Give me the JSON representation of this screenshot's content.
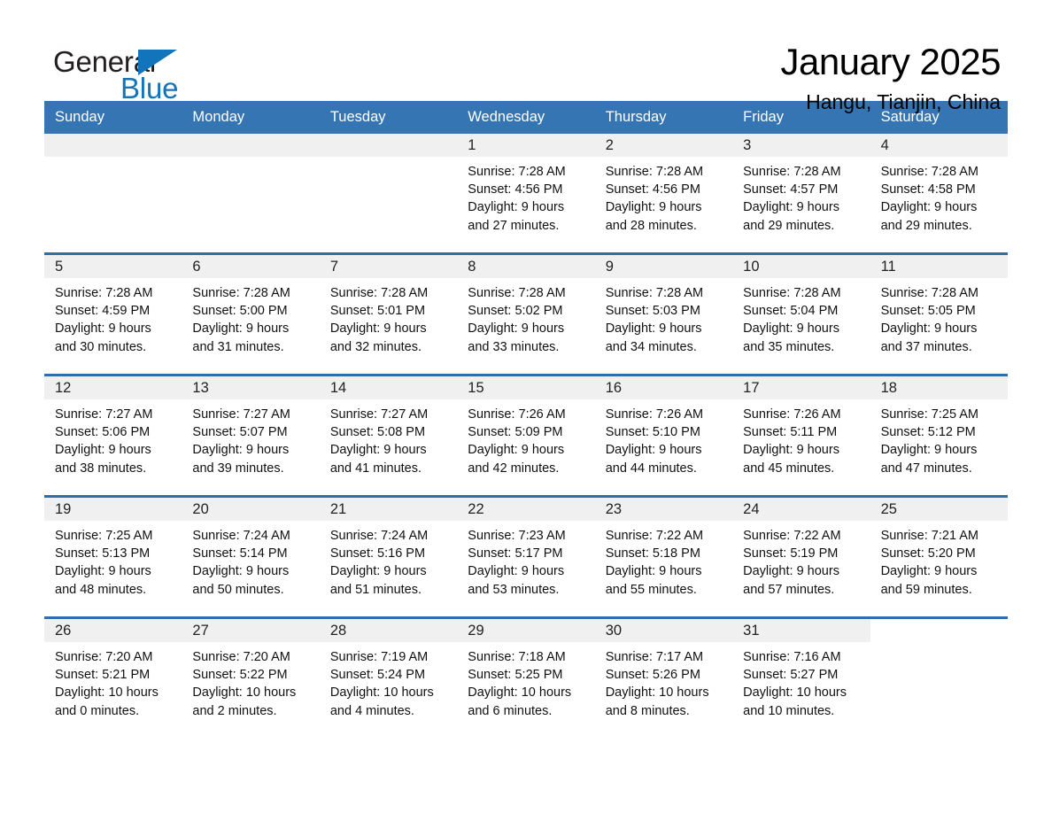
{
  "brand": {
    "name_part1": "General",
    "name_part2": "Blue",
    "accent_color": "#1274bb"
  },
  "header": {
    "title": "January 2025",
    "location": "Hangu, Tianjin, China"
  },
  "calendar": {
    "header_bg": "#3575b3",
    "row_border_color": "#2f6ea8",
    "daycell_head_bg": "#f0f0f0",
    "weekdays": [
      "Sunday",
      "Monday",
      "Tuesday",
      "Wednesday",
      "Thursday",
      "Friday",
      "Saturday"
    ],
    "weeks": [
      [
        {
          "day": "",
          "empty": true
        },
        {
          "day": "",
          "empty": true
        },
        {
          "day": "",
          "empty": true
        },
        {
          "day": "1",
          "sunrise": "Sunrise: 7:28 AM",
          "sunset": "Sunset: 4:56 PM",
          "daylight_line1": "Daylight: 9 hours",
          "daylight_line2": "and 27 minutes."
        },
        {
          "day": "2",
          "sunrise": "Sunrise: 7:28 AM",
          "sunset": "Sunset: 4:56 PM",
          "daylight_line1": "Daylight: 9 hours",
          "daylight_line2": "and 28 minutes."
        },
        {
          "day": "3",
          "sunrise": "Sunrise: 7:28 AM",
          "sunset": "Sunset: 4:57 PM",
          "daylight_line1": "Daylight: 9 hours",
          "daylight_line2": "and 29 minutes."
        },
        {
          "day": "4",
          "sunrise": "Sunrise: 7:28 AM",
          "sunset": "Sunset: 4:58 PM",
          "daylight_line1": "Daylight: 9 hours",
          "daylight_line2": "and 29 minutes."
        }
      ],
      [
        {
          "day": "5",
          "sunrise": "Sunrise: 7:28 AM",
          "sunset": "Sunset: 4:59 PM",
          "daylight_line1": "Daylight: 9 hours",
          "daylight_line2": "and 30 minutes."
        },
        {
          "day": "6",
          "sunrise": "Sunrise: 7:28 AM",
          "sunset": "Sunset: 5:00 PM",
          "daylight_line1": "Daylight: 9 hours",
          "daylight_line2": "and 31 minutes."
        },
        {
          "day": "7",
          "sunrise": "Sunrise: 7:28 AM",
          "sunset": "Sunset: 5:01 PM",
          "daylight_line1": "Daylight: 9 hours",
          "daylight_line2": "and 32 minutes."
        },
        {
          "day": "8",
          "sunrise": "Sunrise: 7:28 AM",
          "sunset": "Sunset: 5:02 PM",
          "daylight_line1": "Daylight: 9 hours",
          "daylight_line2": "and 33 minutes."
        },
        {
          "day": "9",
          "sunrise": "Sunrise: 7:28 AM",
          "sunset": "Sunset: 5:03 PM",
          "daylight_line1": "Daylight: 9 hours",
          "daylight_line2": "and 34 minutes."
        },
        {
          "day": "10",
          "sunrise": "Sunrise: 7:28 AM",
          "sunset": "Sunset: 5:04 PM",
          "daylight_line1": "Daylight: 9 hours",
          "daylight_line2": "and 35 minutes."
        },
        {
          "day": "11",
          "sunrise": "Sunrise: 7:28 AM",
          "sunset": "Sunset: 5:05 PM",
          "daylight_line1": "Daylight: 9 hours",
          "daylight_line2": "and 37 minutes."
        }
      ],
      [
        {
          "day": "12",
          "sunrise": "Sunrise: 7:27 AM",
          "sunset": "Sunset: 5:06 PM",
          "daylight_line1": "Daylight: 9 hours",
          "daylight_line2": "and 38 minutes."
        },
        {
          "day": "13",
          "sunrise": "Sunrise: 7:27 AM",
          "sunset": "Sunset: 5:07 PM",
          "daylight_line1": "Daylight: 9 hours",
          "daylight_line2": "and 39 minutes."
        },
        {
          "day": "14",
          "sunrise": "Sunrise: 7:27 AM",
          "sunset": "Sunset: 5:08 PM",
          "daylight_line1": "Daylight: 9 hours",
          "daylight_line2": "and 41 minutes."
        },
        {
          "day": "15",
          "sunrise": "Sunrise: 7:26 AM",
          "sunset": "Sunset: 5:09 PM",
          "daylight_line1": "Daylight: 9 hours",
          "daylight_line2": "and 42 minutes."
        },
        {
          "day": "16",
          "sunrise": "Sunrise: 7:26 AM",
          "sunset": "Sunset: 5:10 PM",
          "daylight_line1": "Daylight: 9 hours",
          "daylight_line2": "and 44 minutes."
        },
        {
          "day": "17",
          "sunrise": "Sunrise: 7:26 AM",
          "sunset": "Sunset: 5:11 PM",
          "daylight_line1": "Daylight: 9 hours",
          "daylight_line2": "and 45 minutes."
        },
        {
          "day": "18",
          "sunrise": "Sunrise: 7:25 AM",
          "sunset": "Sunset: 5:12 PM",
          "daylight_line1": "Daylight: 9 hours",
          "daylight_line2": "and 47 minutes."
        }
      ],
      [
        {
          "day": "19",
          "sunrise": "Sunrise: 7:25 AM",
          "sunset": "Sunset: 5:13 PM",
          "daylight_line1": "Daylight: 9 hours",
          "daylight_line2": "and 48 minutes."
        },
        {
          "day": "20",
          "sunrise": "Sunrise: 7:24 AM",
          "sunset": "Sunset: 5:14 PM",
          "daylight_line1": "Daylight: 9 hours",
          "daylight_line2": "and 50 minutes."
        },
        {
          "day": "21",
          "sunrise": "Sunrise: 7:24 AM",
          "sunset": "Sunset: 5:16 PM",
          "daylight_line1": "Daylight: 9 hours",
          "daylight_line2": "and 51 minutes."
        },
        {
          "day": "22",
          "sunrise": "Sunrise: 7:23 AM",
          "sunset": "Sunset: 5:17 PM",
          "daylight_line1": "Daylight: 9 hours",
          "daylight_line2": "and 53 minutes."
        },
        {
          "day": "23",
          "sunrise": "Sunrise: 7:22 AM",
          "sunset": "Sunset: 5:18 PM",
          "daylight_line1": "Daylight: 9 hours",
          "daylight_line2": "and 55 minutes."
        },
        {
          "day": "24",
          "sunrise": "Sunrise: 7:22 AM",
          "sunset": "Sunset: 5:19 PM",
          "daylight_line1": "Daylight: 9 hours",
          "daylight_line2": "and 57 minutes."
        },
        {
          "day": "25",
          "sunrise": "Sunrise: 7:21 AM",
          "sunset": "Sunset: 5:20 PM",
          "daylight_line1": "Daylight: 9 hours",
          "daylight_line2": "and 59 minutes."
        }
      ],
      [
        {
          "day": "26",
          "sunrise": "Sunrise: 7:20 AM",
          "sunset": "Sunset: 5:21 PM",
          "daylight_line1": "Daylight: 10 hours",
          "daylight_line2": "and 0 minutes."
        },
        {
          "day": "27",
          "sunrise": "Sunrise: 7:20 AM",
          "sunset": "Sunset: 5:22 PM",
          "daylight_line1": "Daylight: 10 hours",
          "daylight_line2": "and 2 minutes."
        },
        {
          "day": "28",
          "sunrise": "Sunrise: 7:19 AM",
          "sunset": "Sunset: 5:24 PM",
          "daylight_line1": "Daylight: 10 hours",
          "daylight_line2": "and 4 minutes."
        },
        {
          "day": "29",
          "sunrise": "Sunrise: 7:18 AM",
          "sunset": "Sunset: 5:25 PM",
          "daylight_line1": "Daylight: 10 hours",
          "daylight_line2": "and 6 minutes."
        },
        {
          "day": "30",
          "sunrise": "Sunrise: 7:17 AM",
          "sunset": "Sunset: 5:26 PM",
          "daylight_line1": "Daylight: 10 hours",
          "daylight_line2": "and 8 minutes."
        },
        {
          "day": "31",
          "sunrise": "Sunrise: 7:16 AM",
          "sunset": "Sunset: 5:27 PM",
          "daylight_line1": "Daylight: 10 hours",
          "daylight_line2": "and 10 minutes."
        },
        {
          "day": "",
          "empty": true,
          "blank_body": true
        }
      ]
    ]
  }
}
